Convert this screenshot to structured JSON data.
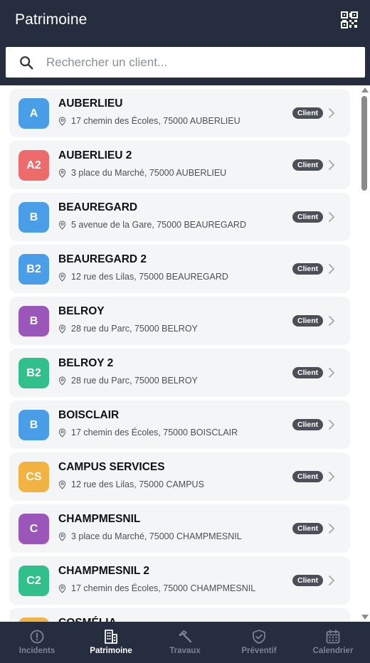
{
  "header": {
    "title": "Patrimoine"
  },
  "search": {
    "placeholder": "Rechercher un client..."
  },
  "clients": [
    {
      "initials": "A",
      "name": "AUBERLIEU",
      "address": "17 chemin des Écoles, 75000 AUBERLIEU",
      "badge": "Client",
      "color": "#4a9ee8"
    },
    {
      "initials": "A2",
      "name": "AUBERLIEU 2",
      "address": "3 place du Marché, 75000 AUBERLIEU",
      "badge": "Client",
      "color": "#ee6b6b"
    },
    {
      "initials": "B",
      "name": "BEAUREGARD",
      "address": "5 avenue de la Gare, 75000 BEAUREGARD",
      "badge": "Client",
      "color": "#4a9ee8"
    },
    {
      "initials": "B2",
      "name": "BEAUREGARD 2",
      "address": "12 rue des Lilas, 75000 BEAUREGARD",
      "badge": "Client",
      "color": "#4a9ee8"
    },
    {
      "initials": "B",
      "name": "BELROY",
      "address": "28 rue du Parc, 75000 BELROY",
      "badge": "Client",
      "color": "#9a56b8"
    },
    {
      "initials": "B2",
      "name": "BELROY 2",
      "address": "28 rue du Parc, 75000 BELROY",
      "badge": "Client",
      "color": "#31c08c"
    },
    {
      "initials": "B",
      "name": "BOISCLAIR",
      "address": "17 chemin des Écoles, 75000 BOISCLAIR",
      "badge": "Client",
      "color": "#4a9ee8"
    },
    {
      "initials": "CS",
      "name": "CAMPUS SERVICES",
      "address": "12 rue des Lilas, 75000 CAMPUS",
      "badge": "Client",
      "color": "#f1b443"
    },
    {
      "initials": "C",
      "name": "CHAMPMESNIL",
      "address": "3 place du Marché, 75000 CHAMPMESNIL",
      "badge": "Client",
      "color": "#9a56b8"
    },
    {
      "initials": "C2",
      "name": "CHAMPMESNIL 2",
      "address": "17 chemin des Écoles, 75000 CHAMPMESNIL",
      "badge": "Client",
      "color": "#31c08c"
    },
    {
      "initials": "",
      "name": "COSMÉLIA",
      "address": "",
      "badge": "",
      "color": "#f1b443"
    }
  ],
  "nav": [
    {
      "label": "Incidents",
      "icon": "alert-circle-icon",
      "active": false
    },
    {
      "label": "Patrimoine",
      "icon": "building-icon",
      "active": true
    },
    {
      "label": "Travaux",
      "icon": "hammer-icon",
      "active": false
    },
    {
      "label": "Préventif",
      "icon": "shield-check-icon",
      "active": false
    },
    {
      "label": "Calendrier",
      "icon": "calendar-icon",
      "active": false
    }
  ]
}
